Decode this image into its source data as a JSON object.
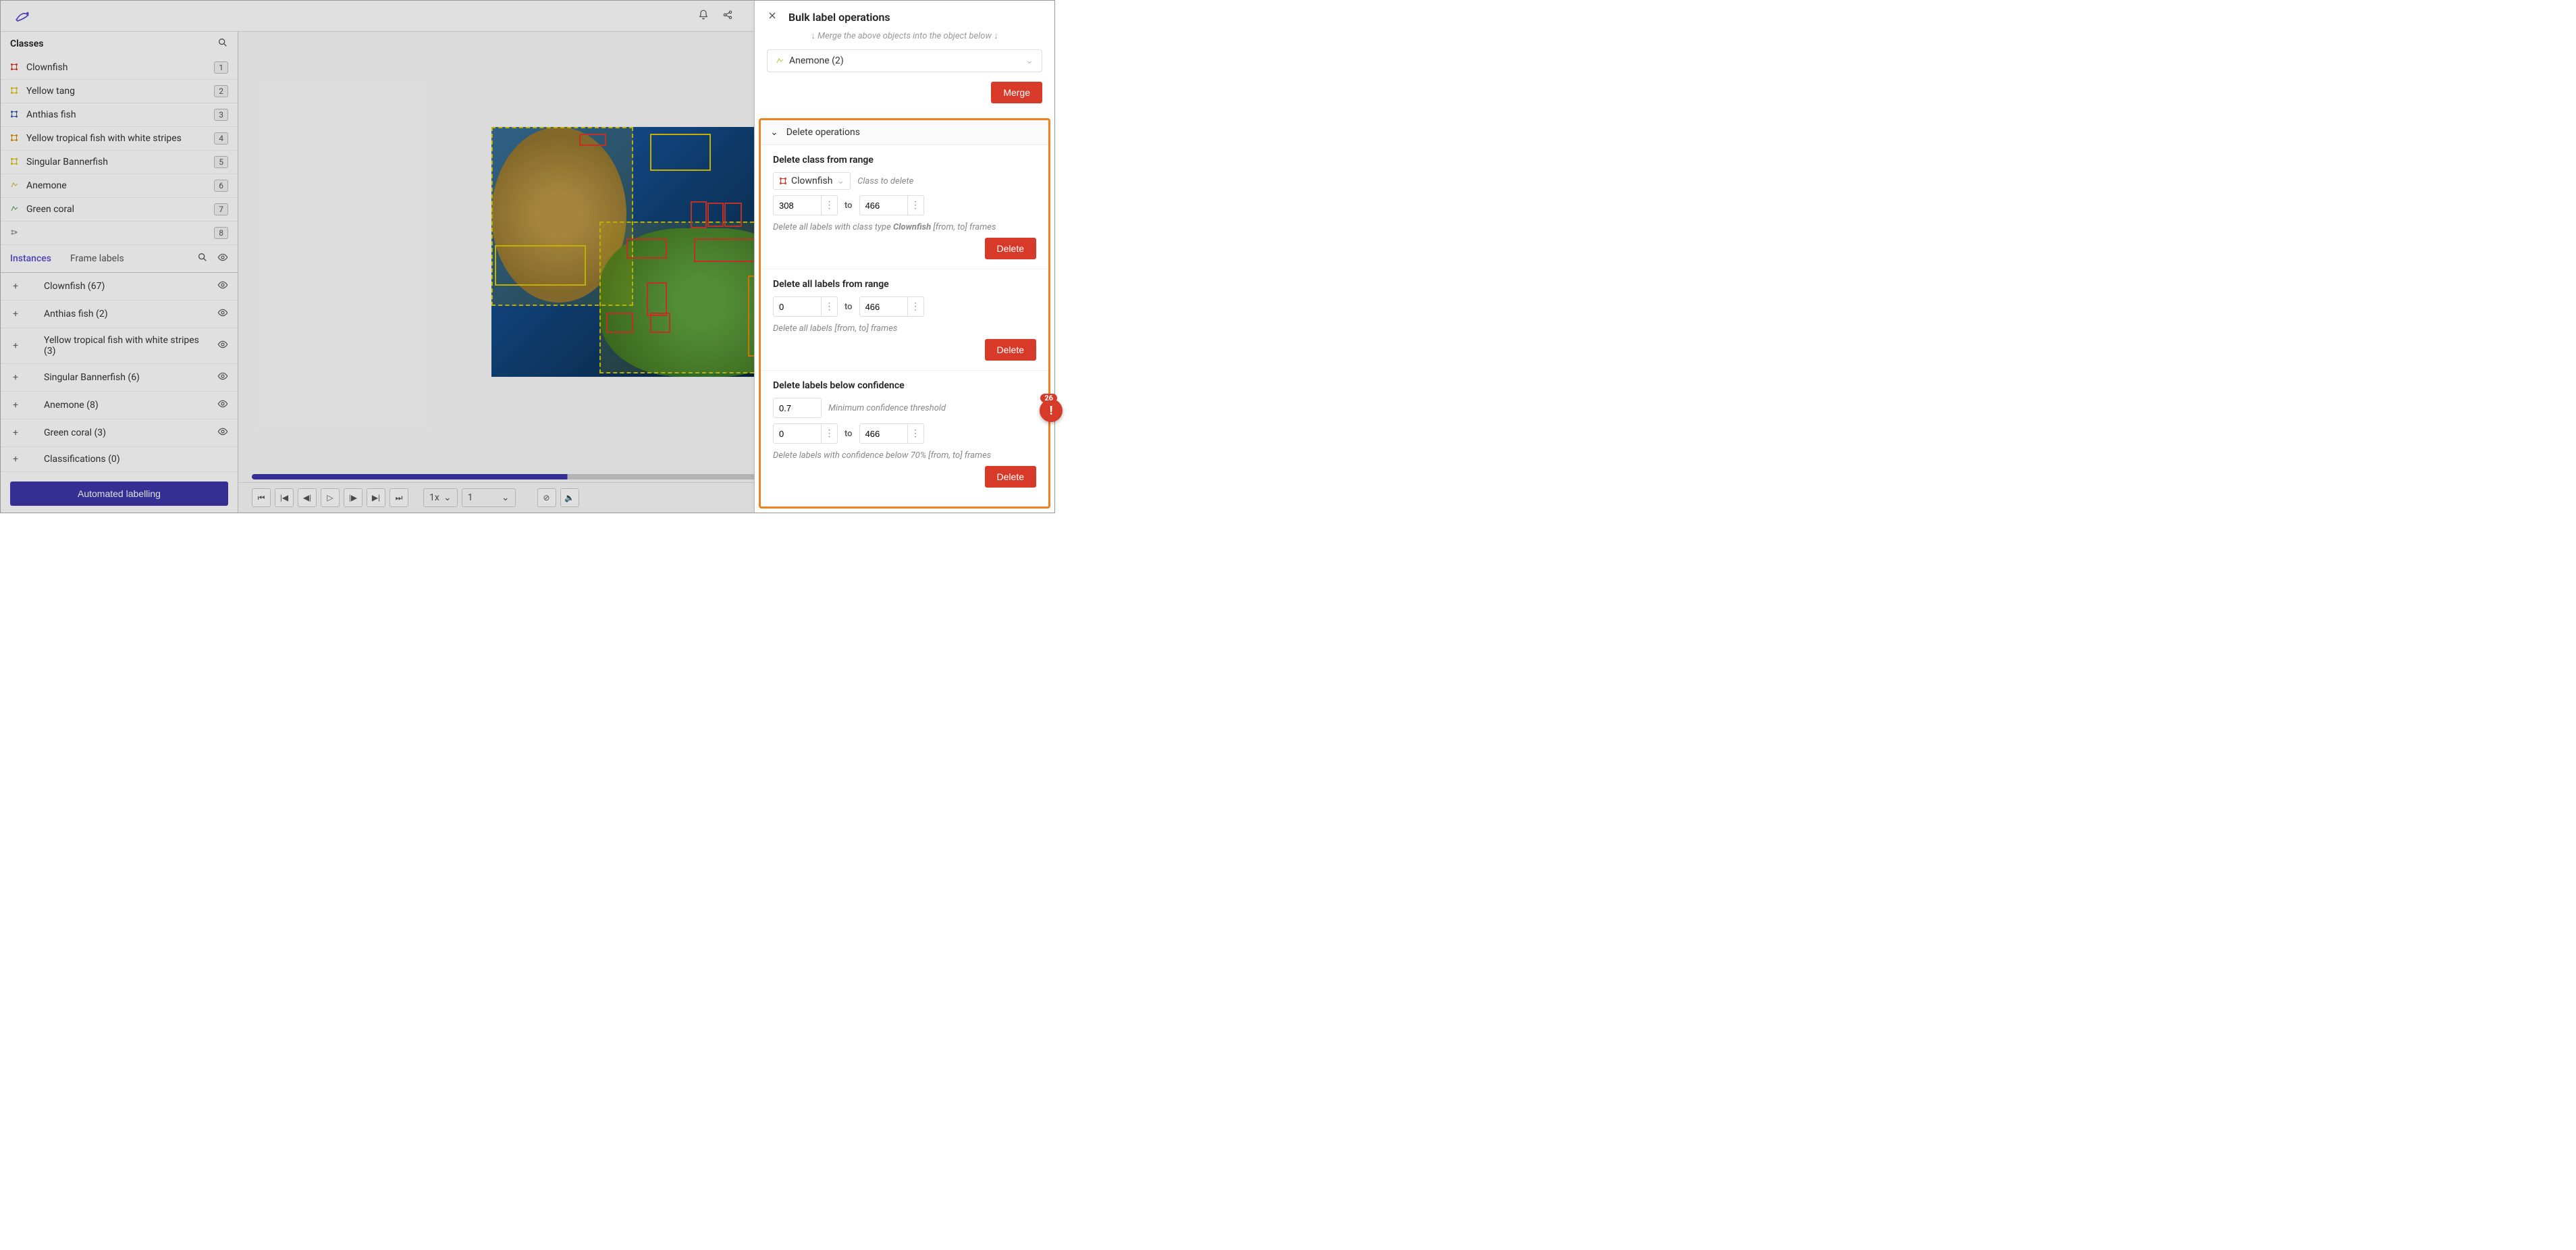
{
  "topbar": {},
  "classes_header": "Classes",
  "classes": [
    {
      "name": "Clownfish",
      "badge": "1",
      "color": "#d83a2a",
      "shape": "box"
    },
    {
      "name": "Yellow tang",
      "badge": "2",
      "color": "#e0c800",
      "shape": "box"
    },
    {
      "name": "Anthias fish",
      "badge": "3",
      "color": "#3d5da8",
      "shape": "box"
    },
    {
      "name": "Yellow tropical fish with white stripes",
      "badge": "4",
      "color": "#e08a00",
      "shape": "box"
    },
    {
      "name": "Singular Bannerfish",
      "badge": "5",
      "color": "#d8c900",
      "shape": "box"
    },
    {
      "name": "Anemone",
      "badge": "6",
      "color": "#c9b84a",
      "shape": "poly"
    },
    {
      "name": "Green coral",
      "badge": "7",
      "color": "#4a9a4a",
      "shape": "poly"
    },
    {
      "name": "",
      "badge": "8",
      "color": "#888",
      "shape": "split"
    }
  ],
  "tabs": {
    "instances": "Instances",
    "frame_labels": "Frame labels"
  },
  "instances": [
    {
      "label": "Clownfish (67)"
    },
    {
      "label": "Anthias fish (2)"
    },
    {
      "label": "Yellow tropical fish with white stripes (3)"
    },
    {
      "label": "Singular Bannerfish (6)"
    },
    {
      "label": "Anemone (8)"
    },
    {
      "label": "Green coral (3)"
    },
    {
      "label": "Classifications (0)",
      "no_eye": true
    }
  ],
  "auto_label_btn": "Automated labelling",
  "controls": {
    "speed": "1x",
    "frame": "1"
  },
  "panel": {
    "title": "Bulk label operations",
    "merge_hint": "↓ Merge the above objects into the object below ↓",
    "merge_target": "Anemone (2)",
    "merge_btn": "Merge",
    "delete_ops_header": "Delete operations",
    "del_class": {
      "heading": "Delete class from range",
      "class": "Clownfish",
      "class_hint": "Class to delete",
      "from": "308",
      "to": "466",
      "to_label": "to",
      "hint_pre": "Delete all labels with class type ",
      "hint_class": "Clownfish",
      "hint_post": " [from, to] frames",
      "btn": "Delete"
    },
    "del_range": {
      "heading": "Delete all labels from range",
      "from": "0",
      "to": "466",
      "to_label": "to",
      "hint": "Delete all labels [from, to] frames",
      "btn": "Delete"
    },
    "del_conf": {
      "heading": "Delete labels below confidence",
      "threshold": "0.7",
      "threshold_hint": "Minimum confidence threshold",
      "from": "0",
      "to": "466",
      "to_label": "to",
      "hint": "Delete labels with confidence below 70% [from, to] frames",
      "btn": "Delete"
    }
  },
  "alert_count": "26"
}
